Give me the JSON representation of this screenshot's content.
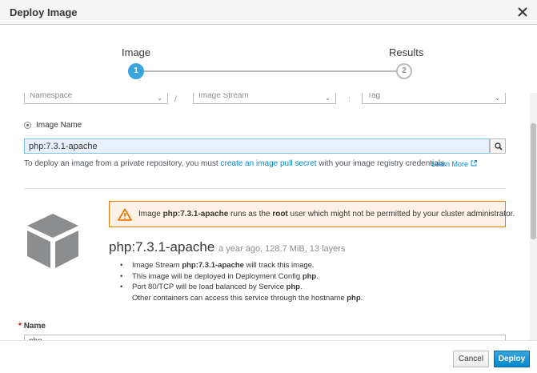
{
  "dialog": {
    "title": "Deploy Image"
  },
  "wizard": {
    "steps": [
      {
        "label": "Image",
        "number": "1"
      },
      {
        "label": "Results",
        "number": "2"
      }
    ]
  },
  "selectors": {
    "namespace": "Namespace",
    "separator1": "/",
    "image_stream": "Image Stream",
    "separator2": ":",
    "tag": "Tag"
  },
  "image_name": {
    "radio_label": "Image Name",
    "value": "php:7.3.1-apache",
    "helper_before": "To deploy an image from a private repository, you must ",
    "helper_link": "create an image pull secret",
    "helper_after": " with your image registry credentials.",
    "learn_more": "Learn More"
  },
  "alert": {
    "prefix": "Image ",
    "image": "php:7.3.1-apache",
    "middle": " runs as the ",
    "user": "root",
    "suffix": " user which might not be permitted by your cluster administrator."
  },
  "image_info": {
    "name": "php:7.3.1-apache",
    "meta": "a year ago, 128.7 MiB, 13 layers"
  },
  "bullets": {
    "b1_pre": "Image Stream ",
    "b1_bold": "php:7.3.1-apache",
    "b1_post": " will track this image.",
    "b2_pre": "This image will be deployed in Deployment Config ",
    "b2_bold": "php",
    "b2_post": ".",
    "b3_pre": "Port 80/TCP will be load balanced by Service ",
    "b3_bold": "php",
    "b3_post": ".",
    "b4_pre": "Other containers can access this service through the hostname ",
    "b4_bold": "php",
    "b4_post": "."
  },
  "name_field": {
    "required_marker": "*",
    "label": "Name",
    "value": "php"
  },
  "footer": {
    "cancel_label": "Cancel",
    "deploy_label": "Deploy"
  },
  "colors": {
    "primary": "#0088ce",
    "step_active": "#39a5dc",
    "warning": "#ec7a08"
  }
}
